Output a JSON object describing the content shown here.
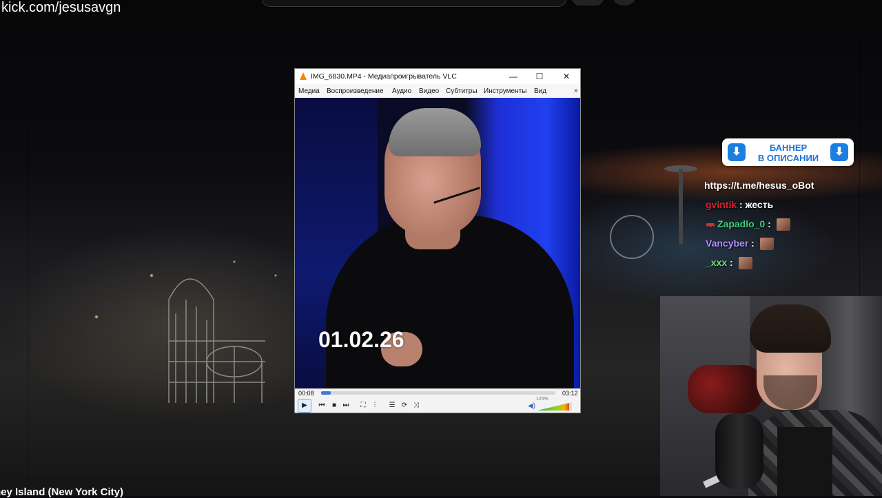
{
  "page": {
    "url_text": "kick.com/jesusavgn",
    "bottom_title": "ney Island (New York City)"
  },
  "vlc": {
    "title": "IMG_6830.MP4 - Медиапроигрыватель VLC",
    "window_buttons": {
      "minimize": "—",
      "maximize": "☐",
      "close": "✕"
    },
    "menu": [
      "Медиа",
      "Воспроизведение",
      "Аудио",
      "Видео",
      "Субтитры",
      "Инструменты",
      "Вид"
    ],
    "menu_more": "»",
    "video_overlay_text": "01.02.26",
    "time_current": "00:08",
    "time_total": "03:12",
    "progress_fraction": 0.04,
    "volume_text": "125%",
    "volume_fraction": 0.92,
    "controls": {
      "play": "▶",
      "prev": "⏮",
      "stop": "■",
      "next": "⏭",
      "fullscreen": "⛶",
      "ext_settings": "⫶",
      "playlist": "☰",
      "loop": "⟳",
      "shuffle": "⤨"
    }
  },
  "banner": {
    "line1": "БАННЕР",
    "line2": "В ОПИСАНИИ",
    "arrow_icon": "download-arrow-icon"
  },
  "chat": {
    "link": "https://t.me/hesus_oBot",
    "messages": [
      {
        "user": "gvintik",
        "text": "жесть",
        "color": "#e0202a"
      },
      {
        "user": "Zapadlo_0",
        "text": "",
        "color": "#3fd17a"
      },
      {
        "user": "Vancyber",
        "text": "",
        "color": "#b28cff"
      },
      {
        "user": "_xxx",
        "text": "",
        "color": "#6ee36e"
      }
    ]
  },
  "colors": {
    "vlc_accent": "#f08a00",
    "seek_fill": "#3d7bd6",
    "banner_blue": "#1c74d6"
  }
}
